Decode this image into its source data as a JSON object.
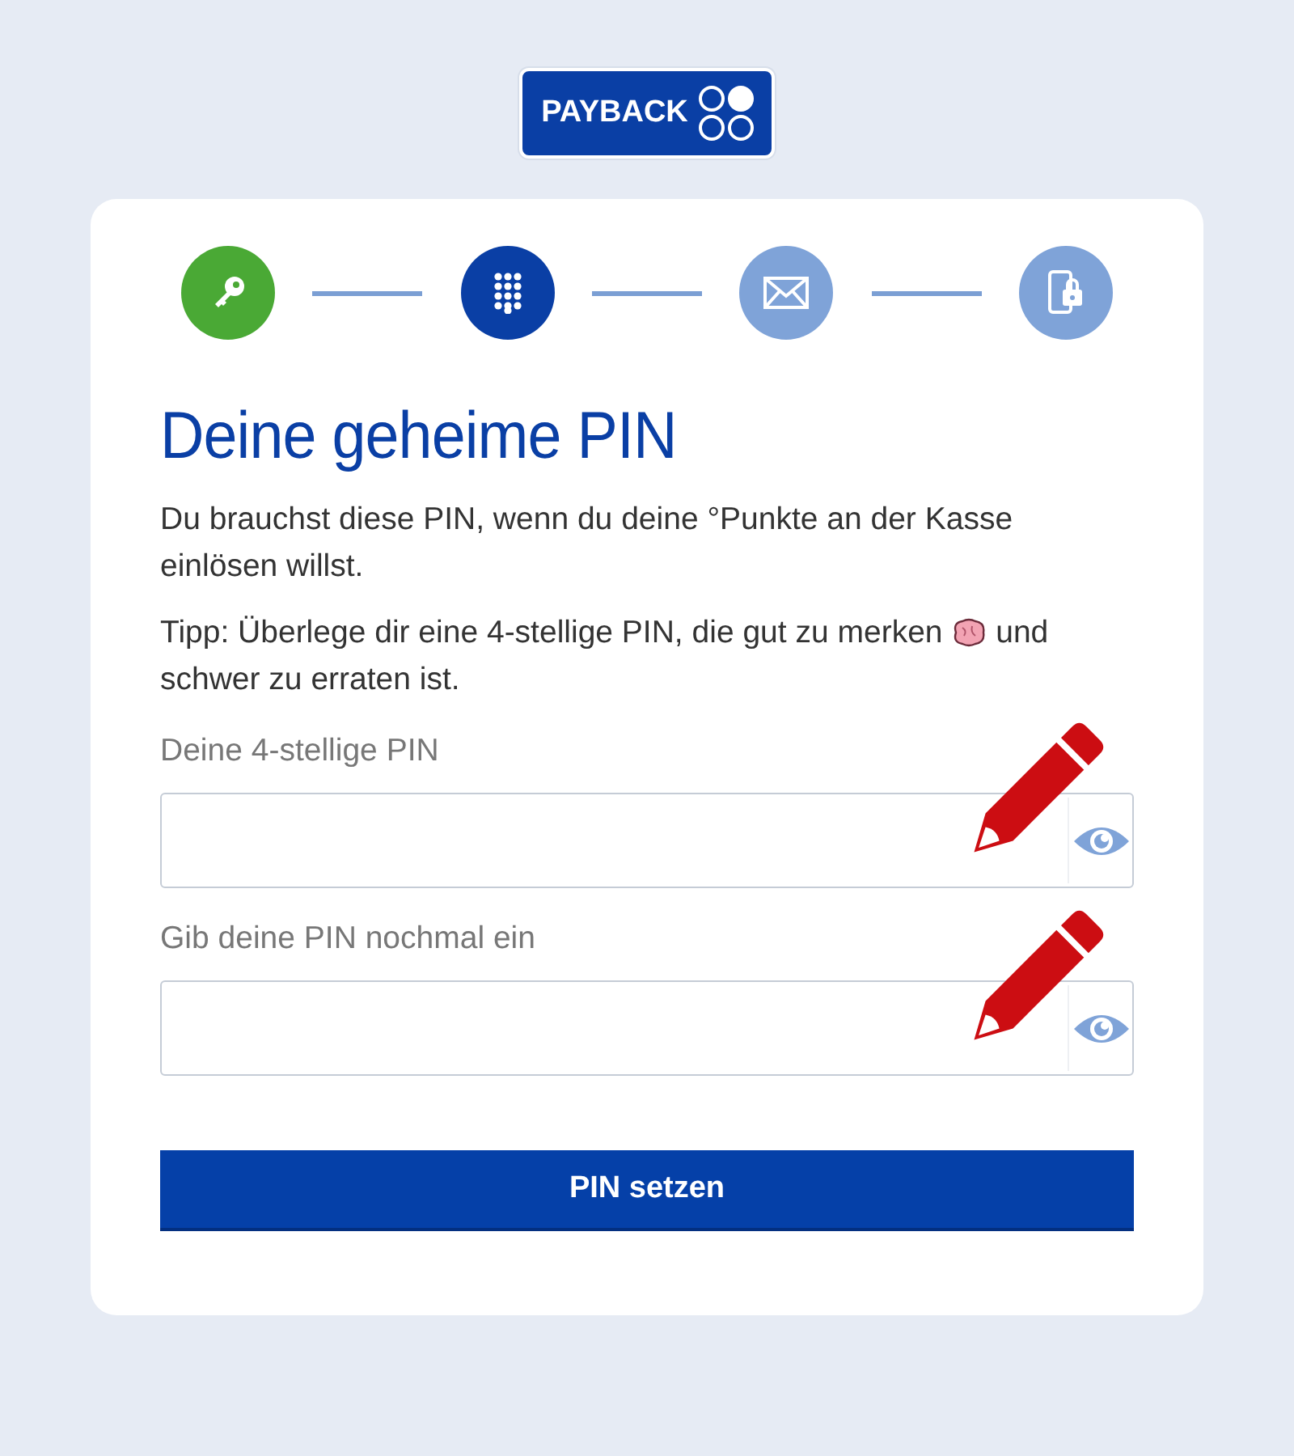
{
  "logo": {
    "text": "PAYBACK"
  },
  "steps": [
    {
      "kind": "key",
      "completed": true,
      "selected": false
    },
    {
      "kind": "keypad",
      "completed": false,
      "selected": true
    },
    {
      "kind": "mail",
      "completed": false,
      "selected": false
    },
    {
      "kind": "phone-lock",
      "completed": false,
      "selected": false
    }
  ],
  "heading": "Deine geheime PIN",
  "intro": "Du brauchst diese PIN, wenn du deine °Punkte an der Kasse einlösen willst.",
  "tip": {
    "before": "Tipp: Überlege dir eine 4-stellige PIN, die gut zu merken",
    "after": "und schwer zu erraten ist."
  },
  "fields": [
    {
      "label": "Deine 4-stellige PIN"
    },
    {
      "label": "Gib deine PIN nochmal ein"
    }
  ],
  "submit": "PIN setzen"
}
